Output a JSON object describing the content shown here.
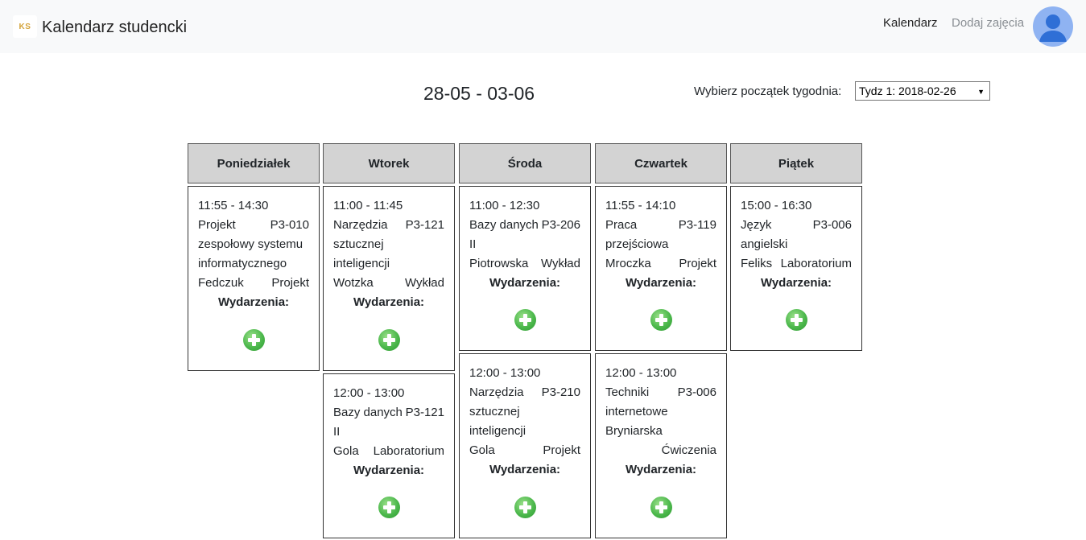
{
  "navbar": {
    "logo_text": "KS",
    "brand": "Kalendarz studencki",
    "links": [
      "Kalendarz",
      "Dodaj zajęcia"
    ],
    "avatar_icon": "user-avatar-icon"
  },
  "week": {
    "title": "28-05 - 03-06",
    "picker_label": "Wybierz początek tygodnia:",
    "selected": "Tydz 1: 2018-02-26"
  },
  "events_label": "Wydarzenia:",
  "days": [
    {
      "name": "Poniedziałek",
      "classes": [
        {
          "time": "11:55 - 14:30",
          "lines": [
            [
              "Projekt",
              "P3-010"
            ],
            [
              "zespołowy systemu",
              ""
            ],
            [
              "informatycznego",
              ""
            ],
            [
              "Fedczuk",
              "Projekt"
            ]
          ]
        }
      ]
    },
    {
      "name": "Wtorek",
      "classes": [
        {
          "time": "11:00 - 11:45",
          "lines": [
            [
              "Narzędzia",
              "P3-121"
            ],
            [
              "sztucznej",
              ""
            ],
            [
              "inteligencji",
              ""
            ],
            [
              "Wotzka",
              "Wykład"
            ]
          ]
        },
        {
          "time": "12:00 - 13:00",
          "lines": [
            [
              "Bazy danych",
              "P3-121"
            ],
            [
              "II",
              ""
            ],
            [
              "Gola",
              "Laboratorium"
            ]
          ]
        }
      ]
    },
    {
      "name": "Środa",
      "classes": [
        {
          "time": "11:00 - 12:30",
          "lines": [
            [
              "Bazy danych",
              "P3-206"
            ],
            [
              "II",
              ""
            ],
            [
              "Piotrowska",
              "Wykład"
            ]
          ]
        },
        {
          "time": "12:00 - 13:00",
          "lines": [
            [
              "Narzędzia",
              "P3-210"
            ],
            [
              "sztucznej",
              ""
            ],
            [
              "inteligencji",
              ""
            ],
            [
              "Gola",
              "Projekt"
            ]
          ]
        }
      ]
    },
    {
      "name": "Czwartek",
      "classes": [
        {
          "time": "11:55 - 14:10",
          "lines": [
            [
              "Praca",
              "P3-119"
            ],
            [
              "przejściowa",
              ""
            ],
            [
              "Mroczka",
              "Projekt"
            ]
          ]
        },
        {
          "time": "12:00 - 13:00",
          "lines": [
            [
              "Techniki",
              "P3-006"
            ],
            [
              "internetowe",
              ""
            ],
            [
              "Bryniarska",
              ""
            ],
            [
              "",
              "Ćwiczenia"
            ]
          ]
        }
      ]
    },
    {
      "name": "Piątek",
      "classes": [
        {
          "time": "15:00 - 16:30",
          "lines": [
            [
              "Język",
              "P3-006"
            ],
            [
              "angielski",
              ""
            ],
            [
              "Feliks",
              "Laboratorium"
            ]
          ]
        }
      ]
    }
  ]
}
